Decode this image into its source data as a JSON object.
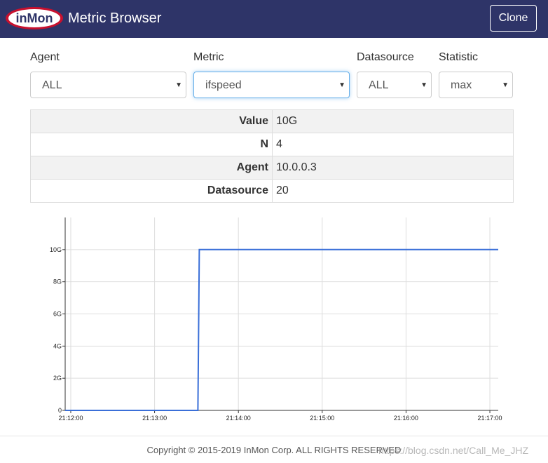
{
  "header": {
    "logo_text": "inMon",
    "title": "Metric Browser",
    "clone_label": "Clone",
    "colors": {
      "navbar": "#2e3468",
      "logo_red": "#c8102e"
    }
  },
  "filters": [
    {
      "label": "Agent",
      "value": "ALL"
    },
    {
      "label": "Metric",
      "value": "ifspeed"
    },
    {
      "label": "Datasource",
      "value": "ALL"
    },
    {
      "label": "Statistic",
      "value": "max"
    }
  ],
  "info": [
    {
      "key": "Value",
      "value": "10G"
    },
    {
      "key": "N",
      "value": "4"
    },
    {
      "key": "Agent",
      "value": "10.0.0.3"
    },
    {
      "key": "Datasource",
      "value": "20"
    }
  ],
  "chart_data": {
    "type": "line",
    "title": "",
    "xlabel": "",
    "ylabel": "",
    "x_ticks": [
      "21:12:00",
      "21:13:00",
      "21:14:00",
      "21:15:00",
      "21:16:00",
      "21:17:00"
    ],
    "y_ticks": [
      "0",
      "2G",
      "4G",
      "6G",
      "8G",
      "10G"
    ],
    "ylim": [
      0,
      12000000000
    ],
    "xlim": [
      "21:11:56",
      "21:17:06"
    ],
    "grid": true,
    "line_color": "#3a6fd8",
    "series": [
      {
        "x": [
          "21:11:56",
          "21:13:31",
          "21:13:32",
          "21:17:06"
        ],
        "values": [
          0,
          0,
          10000000000,
          10000000000
        ]
      }
    ]
  },
  "footer": {
    "copyright": "Copyright © 2015-2019 InMon Corp. ALL RIGHTS RESERVED",
    "watermark": "https://blog.csdn.net/Call_Me_JHZ"
  }
}
